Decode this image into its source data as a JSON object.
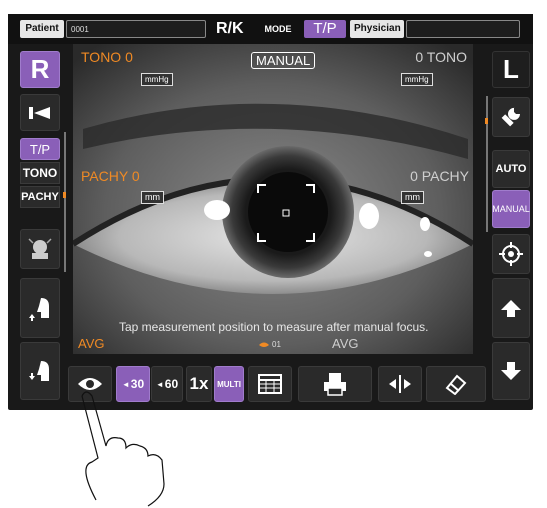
{
  "topbar": {
    "patient_label": "Patient",
    "patient_id": "0001",
    "rk_label": "R/K",
    "mode_label": "MODE",
    "mode_value": "T/P",
    "physician_label": "Physician",
    "physician_value": ""
  },
  "left": {
    "eye_label": "R",
    "tp_label": "T/P",
    "tono_label": "TONO",
    "pachy_label": "PACHY"
  },
  "right": {
    "eye_label": "L",
    "auto_label": "AUTO",
    "manual_label": "MANUAL"
  },
  "camera": {
    "tono_left": "TONO 0",
    "tono_right": "0 TONO",
    "mode_badge": "MANUAL",
    "unit_mmhg": "mmHg",
    "pachy_left": "PACHY 0",
    "pachy_right": "0 PACHY",
    "unit_mm": "mm",
    "instruction": "Tap measurement position to measure after manual focus.",
    "avg_left": "AVG",
    "avg_right": "AVG",
    "count_label": "01"
  },
  "bottom": {
    "angle_30": "30",
    "angle_60": "60",
    "zoom": "1x",
    "multi": "MULTI"
  },
  "colors": {
    "accent": "#8a5fb8",
    "orange": "#f08a24",
    "background": "#191919"
  },
  "icons": {
    "fixation": "fixation-target-icon",
    "wrench": "wrench-icon",
    "crosshair": "crosshair-icon",
    "chin_up": "chinrest-up-icon",
    "chin_down": "chinrest-down-icon",
    "arrow_up": "arrow-up-icon",
    "arrow_down": "arrow-down-icon",
    "eye": "eye-icon",
    "table": "table-icon",
    "print": "print-icon",
    "split": "split-view-icon",
    "eraser": "eraser-icon"
  }
}
